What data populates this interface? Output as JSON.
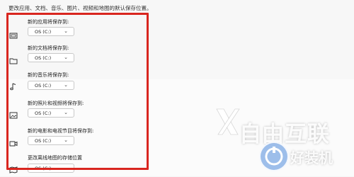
{
  "intro": "更改应用、文档、音乐、图片、视频和地图的默认保存位置。",
  "settings": [
    {
      "label": "新的应用将保存到:",
      "value": "OS (C:)",
      "icon": "app-icon"
    },
    {
      "label": "新的文档将保存到:",
      "value": "OS (C:)",
      "icon": "folder-icon"
    },
    {
      "label": "新的音乐将保存到:",
      "value": "OS (C:)",
      "icon": "music-icon"
    },
    {
      "label": "新的照片和视频将保存到:",
      "value": "OS (C:)",
      "icon": "image-icon"
    },
    {
      "label": "新的电影和电视节目将保存到:",
      "value": "OS (C:)",
      "icon": "video-icon"
    },
    {
      "label": "更改离线地图的存储位置",
      "value": "OS (C:)",
      "icon": "map-icon"
    }
  ],
  "watermark": {
    "brand": "自由互联",
    "logo_text": "好装机"
  },
  "colors": {
    "highlight": "#d9261f"
  }
}
